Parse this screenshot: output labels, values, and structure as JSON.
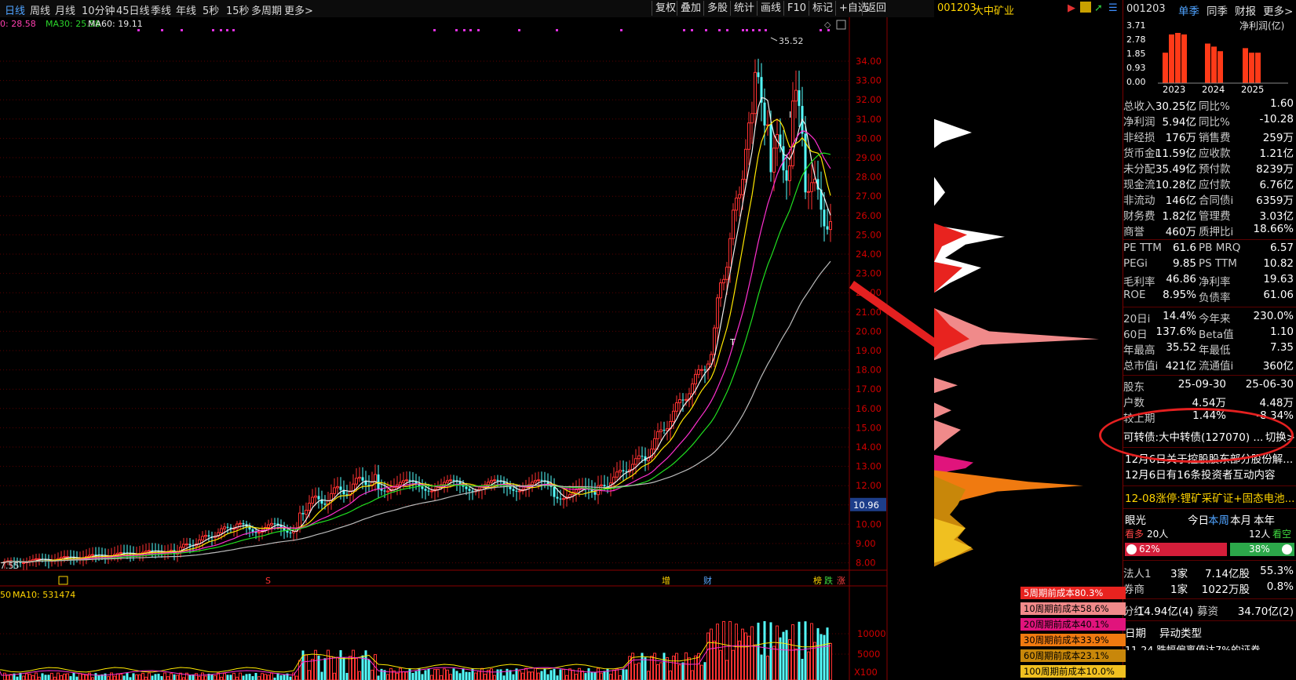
{
  "toolbar": {
    "periods": [
      "日线",
      "周线",
      "月线",
      "10分钟",
      "45日线",
      "季线",
      "年线",
      "5秒",
      "15秒",
      "多周期",
      "更多>"
    ],
    "tools": [
      "复权",
      "叠加",
      "多股",
      "统计",
      "画线",
      "F10",
      "标记",
      "+自选",
      "返回"
    ]
  },
  "stock": {
    "code": "001203",
    "name": "大中矿业"
  },
  "ma_legend": {
    "ma20": "0: 28.58",
    "ma30": "MA30: 25.58",
    "ma60": "MA60: 19.11"
  },
  "chart": {
    "high_label": "35.52",
    "low_label": "7.55",
    "current_price": "10.96",
    "price_ticks": [
      "34.00",
      "33.00",
      "32.00",
      "31.00",
      "30.00",
      "29.00",
      "28.00",
      "27.00",
      "26.00",
      "25.00",
      "24.00",
      "23.00",
      "22.00",
      "21.00",
      "20.00",
      "19.00",
      "18.00",
      "17.00",
      "16.00",
      "15.00",
      "14.00",
      "13.00",
      "12.00",
      "11.00",
      "10.00",
      "9.00",
      "8.00"
    ],
    "event_marks": [
      "增",
      "财",
      "榜",
      "跌",
      "涨"
    ],
    "s_mark": "S",
    "candle_marks": [
      "T",
      "I"
    ]
  },
  "volume": {
    "legend_vol": "50",
    "legend_ma10": "MA10: 531474",
    "ticks": [
      "10000",
      "5000"
    ],
    "unit": "X100"
  },
  "cost_legend": [
    {
      "label": "5周期前成本80.3%",
      "color": "#e8231f"
    },
    {
      "label": "10周期前成本58.6%",
      "color": "#f08a8a"
    },
    {
      "label": "20周期前成本40.1%",
      "color": "#e0147c"
    },
    {
      "label": "30周期前成本33.9%",
      "color": "#f07a10"
    },
    {
      "label": "60周期前成本23.1%",
      "color": "#c8870a"
    },
    {
      "label": "100周期前成本10.0%",
      "color": "#f0c020"
    }
  ],
  "right": {
    "code": "001203",
    "tabs": [
      "单季",
      "同季",
      "财报",
      "更多>"
    ],
    "chart_title": "净利润(亿)",
    "bar_axis": [
      "3.71",
      "2.78",
      "1.85",
      "0.93",
      "0.00"
    ],
    "years": [
      "2023",
      "2024",
      "2025"
    ],
    "fin_rows": [
      [
        "总收入",
        "30.25亿",
        "同比%",
        "1.60"
      ],
      [
        "净利润",
        "5.94亿",
        "同比%",
        "-10.28"
      ],
      [
        "非经损",
        "176万",
        "销售费",
        "259万"
      ],
      [
        "货币金i",
        "11.59亿",
        "应收款",
        "1.21亿"
      ],
      [
        "未分配",
        "35.49亿",
        "预付款",
        "8239万"
      ],
      [
        "现金流",
        "10.28亿",
        "应付款",
        "6.76亿"
      ],
      [
        "非流动",
        "146亿",
        "合同债i",
        "6359万"
      ],
      [
        "财务费",
        "1.82亿",
        "管理费",
        "3.03亿"
      ],
      [
        "商誉",
        "460万",
        "质押比i",
        "18.66%"
      ]
    ],
    "val_rows": [
      [
        "PE TTM",
        "61.6",
        "PB MRQ",
        "6.57"
      ],
      [
        "PEGi",
        "9.85",
        "PS TTM",
        "10.82"
      ],
      [
        "毛利率",
        "46.86",
        "净利率",
        "19.63"
      ],
      [
        "ROE",
        "8.95%",
        "负债率",
        "61.06"
      ]
    ],
    "perf_rows": [
      [
        "20日i",
        "14.4%",
        "今年来",
        "230.0%"
      ],
      [
        "60日",
        "137.6%",
        "Beta值",
        "1.10"
      ],
      [
        "年最高",
        "35.52",
        "年最低",
        "7.35"
      ],
      [
        "总市值i",
        "421亿",
        "流通值i",
        "360亿"
      ]
    ],
    "holder_header": [
      "股东",
      "25-09-30",
      "25-06-30"
    ],
    "holder_rows": [
      [
        "户数",
        "4.54万",
        "4.48万"
      ],
      [
        "较上期",
        "1.44%",
        "-8.34%"
      ]
    ],
    "bond_text": "可转债:大中转债(127070) ...",
    "bond_switch": "切换>",
    "news": [
      "12月6日关于控股股东部分股份解...",
      "12月6日有16条投资者互动内容"
    ],
    "limit_up": "12-08涨停:锂矿采矿证+固态电池...",
    "vision": {
      "title": "眼光",
      "tabs": [
        "今日",
        "本周",
        "本月",
        "本年"
      ],
      "bull_label": "看多",
      "bull_count": "20人",
      "bear_count": "12人",
      "bear_label": "看空",
      "bull_pct": "62%",
      "bear_pct": "38%"
    },
    "inst_rows": [
      [
        "法人1",
        "3家",
        "7.14亿股",
        "55.3%"
      ],
      [
        "券商",
        "1家",
        "1022万股",
        "0.8%"
      ]
    ],
    "dividend": [
      "分红",
      "14.94亿(4)",
      "募资",
      "34.70亿(2)"
    ],
    "event_header": [
      "日期",
      "异动类型"
    ],
    "event_partial": "11-24  跌幅偏离值达7%的证券"
  }
}
